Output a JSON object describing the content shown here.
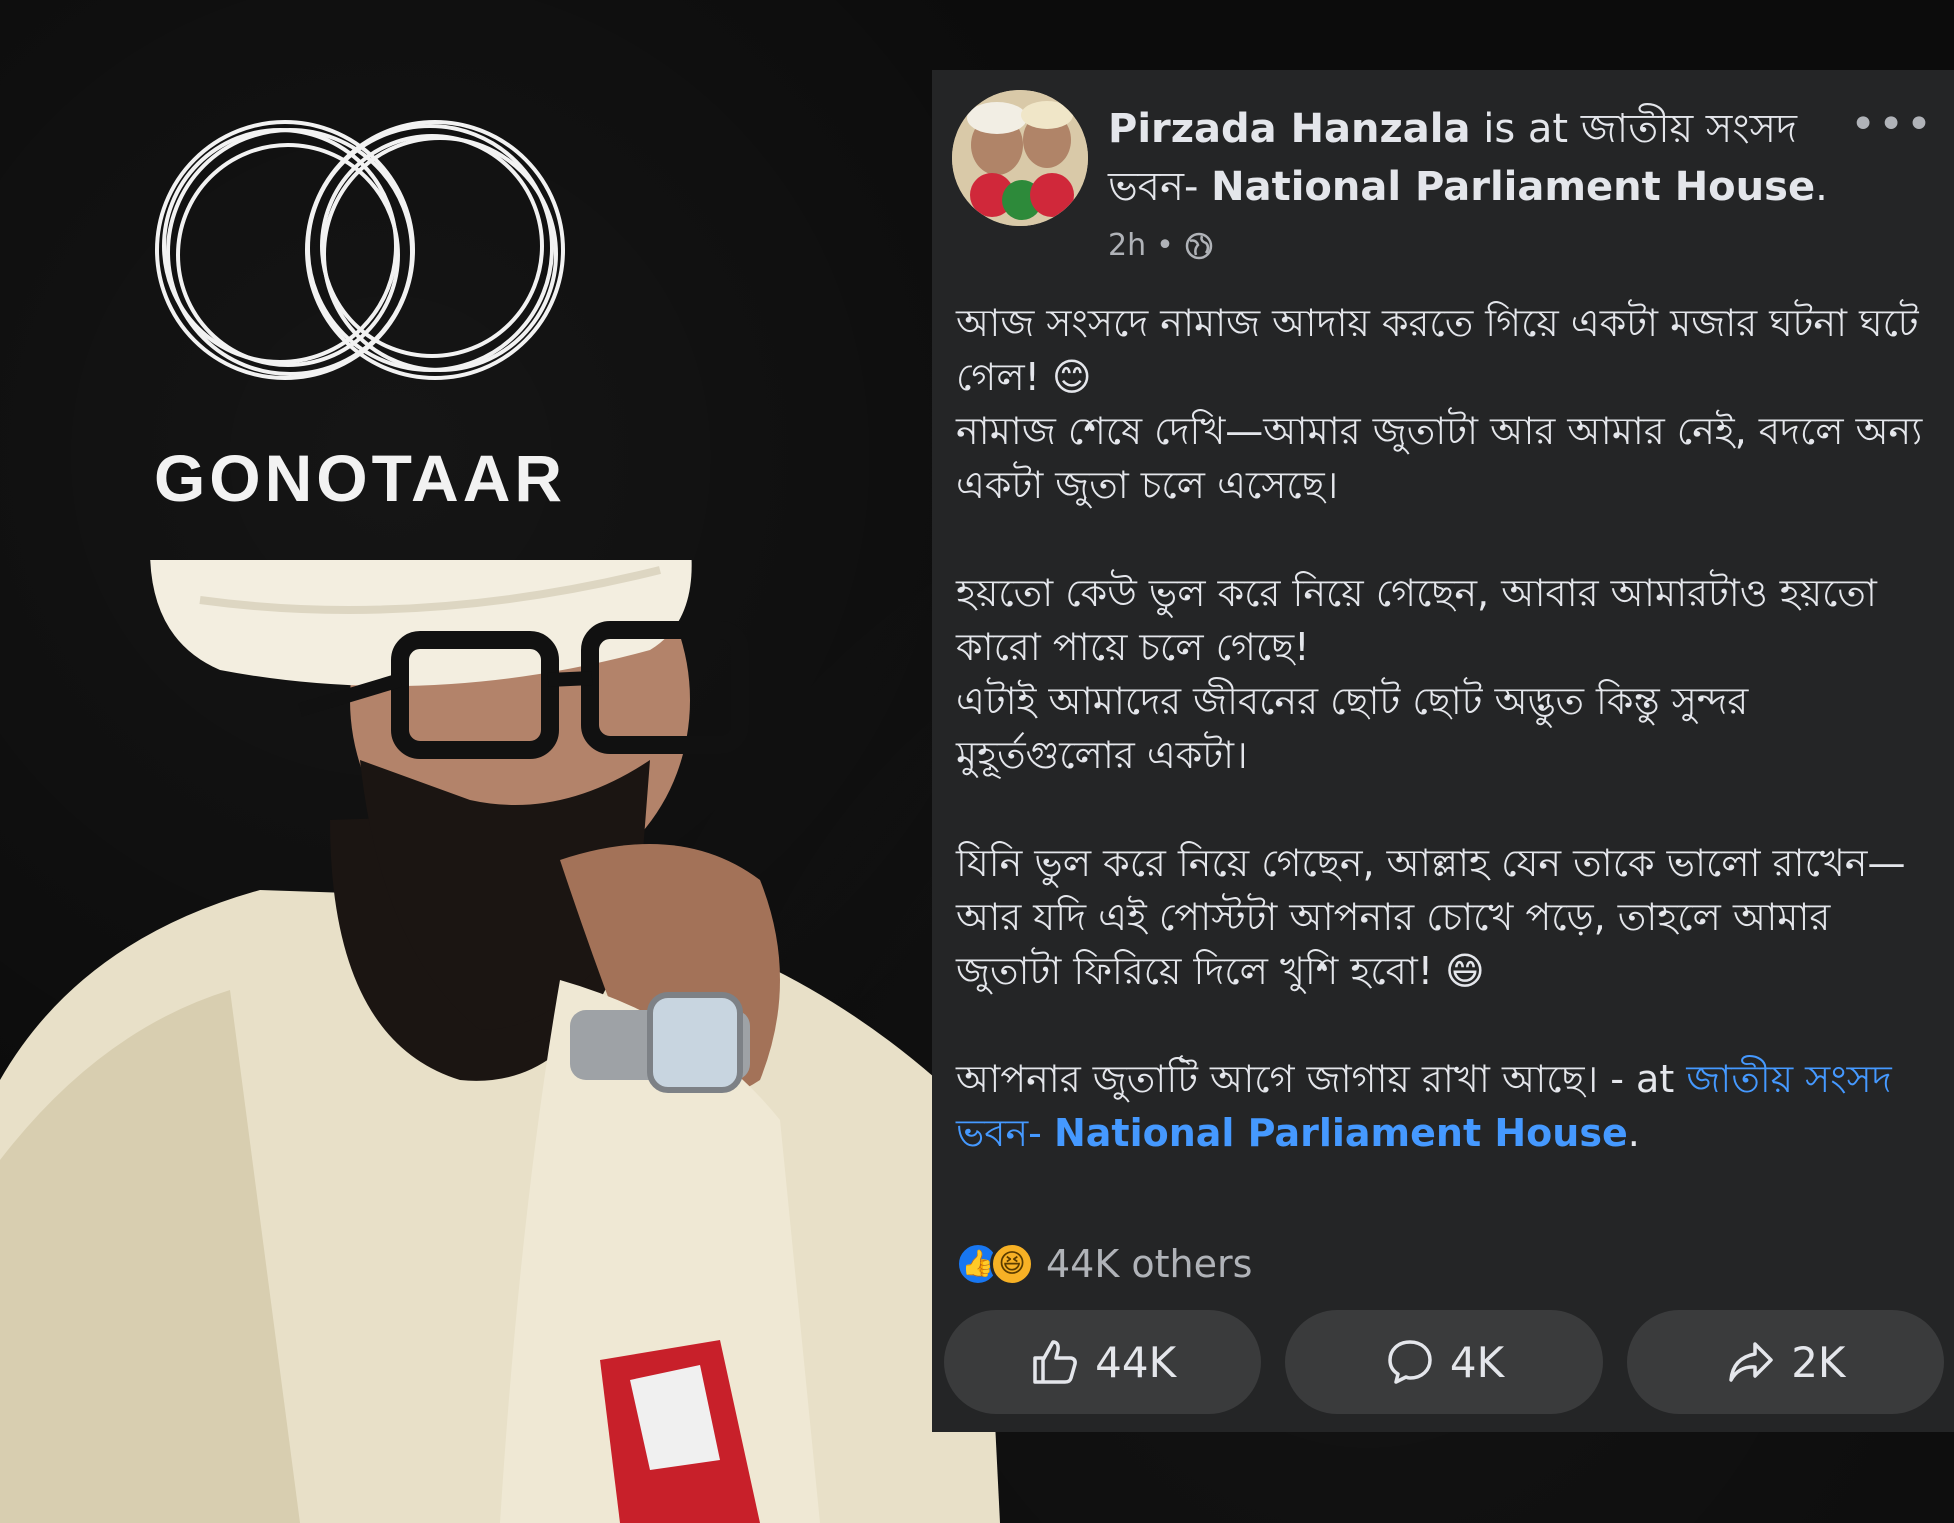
{
  "brand": {
    "name": "GONOTAAR"
  },
  "post": {
    "author": "Pirzada Hanzala",
    "is_at": "is at",
    "location_bengali": "জাতীয় সংসদ ভবন-",
    "location_english": "National Parliament House",
    "location_period": ".",
    "time": "2h",
    "dot": "•",
    "privacy_icon": "globe-icon",
    "more_icon": "more-options-icon",
    "more_label": "•••",
    "paragraphs": [
      "আজ সংসদে নামাজ আদায় করতে গিয়ে একটা মজার ঘটনা ঘটে গেল! 😊\nনামাজ শেষে দেখি—আমার জুতাটা আর আমার নেই, বদলে অন্য একটা জুতা চলে এসেছে।",
      "হয়তো কেউ ভুল করে নিয়ে গেছেন, আবার আমারটাও হয়তো কারো পায়ে চলে গেছে!\nএটাই আমাদের জীবনের ছোট ছোট অদ্ভুত কিন্তু সুন্দর মুহূর্তগুলোর একটা।",
      "যিনি ভুল করে নিয়ে গেছেন, আল্লাহ যেন তাকে ভালো রাখেন—\nআর যদি এই পোস্টটা আপনার চোখে পড়ে, তাহলে আমার জুতাটা ফিরিয়ে দিলে খুশি হবো! 😄"
    ],
    "closing_text": "আপনার জুতাটি আগে জাগায় রাখা আছে। - at",
    "closing_location_bengali": "জাতীয় সংসদ ভবন-",
    "closing_location_english": "National Parliament House",
    "closing_period": ".",
    "reactions": {
      "icons": [
        "like-reaction-icon",
        "haha-reaction-icon"
      ],
      "like_glyph": "👍",
      "haha_glyph": "😆",
      "summary": "44K others"
    },
    "actions": [
      {
        "icon": "thumbs-up-icon",
        "count": "44K"
      },
      {
        "icon": "comment-icon",
        "count": "4K"
      },
      {
        "icon": "share-icon",
        "count": "2K"
      }
    ]
  },
  "colors": {
    "background": "#0c0c0c",
    "card": "#242526",
    "button": "#3a3b3c",
    "text": "#e4e6eb",
    "muted": "#b0b3b8",
    "link": "#4599ff",
    "like_blue": "#1877f2"
  }
}
